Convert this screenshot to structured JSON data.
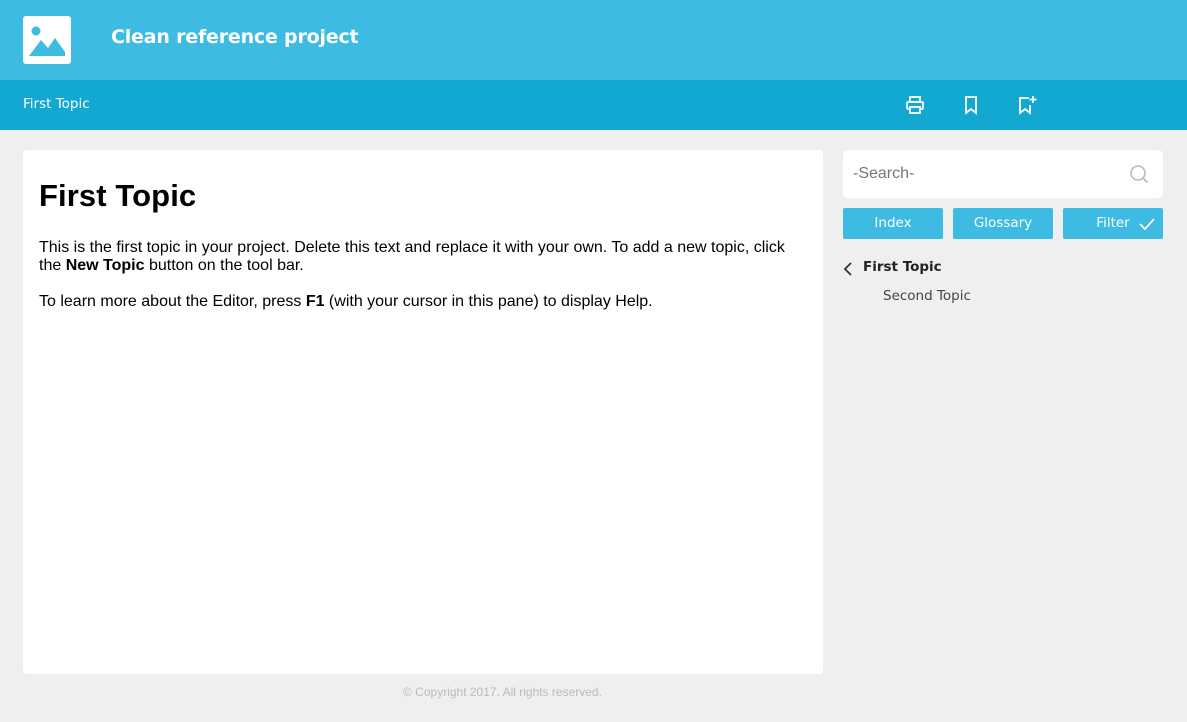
{
  "header": {
    "project_title": "Clean reference project",
    "logo_icon": "image-icon"
  },
  "toolbar": {
    "topic_title": "First Topic",
    "buttons": [
      {
        "name": "print",
        "icon": "printer-icon"
      },
      {
        "name": "bookmark",
        "icon": "bookmark-icon"
      },
      {
        "name": "add-bookmark",
        "icon": "bookmark-plus-icon"
      }
    ]
  },
  "content": {
    "heading": "First Topic",
    "para1_a": "This is the first topic in your project. Delete this text and replace it with your own. To add a new topic, click the ",
    "para1_bold": "New Topic",
    "para1_b": " button on the tool bar.",
    "para2_a": "To learn more about the Editor, press ",
    "para2_bold": "F1",
    "para2_b": " (with your cursor in this pane) to display Help."
  },
  "sidebar": {
    "search": {
      "placeholder": "-Search-",
      "value": ""
    },
    "buttons": {
      "index": "Index",
      "glossary": "Glossary",
      "filter": "Filter"
    },
    "toc": {
      "parent": "First Topic",
      "children": [
        "Second Topic"
      ]
    }
  },
  "footer": {
    "copyright": "© Copyright 2017. All rights reserved."
  },
  "colors": {
    "header_bg": "#3dbbe3",
    "toolbar_bg": "#12a8d1",
    "page_bg": "#efefef",
    "button_bg": "#3dbbe3"
  }
}
